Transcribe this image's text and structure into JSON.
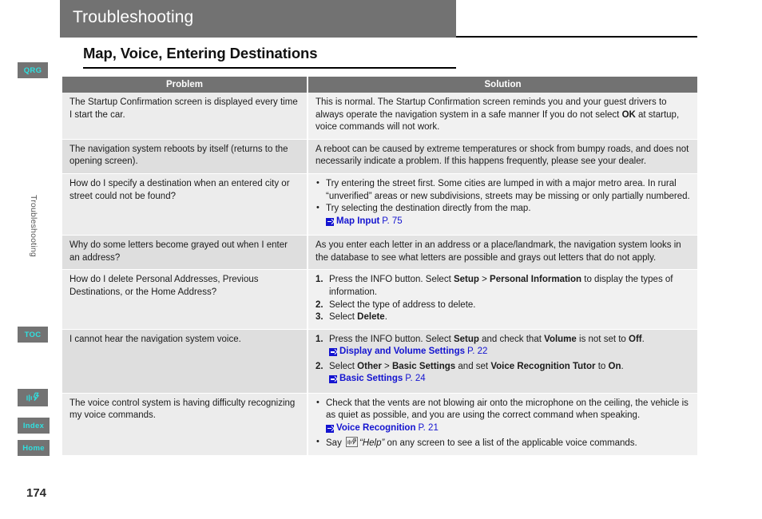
{
  "header": {
    "title": "Troubleshooting"
  },
  "section": {
    "title": "Map, Voice, Entering Destinations"
  },
  "sidebar": {
    "vertical_label": "Troubleshooting",
    "tabs": [
      {
        "id": "qrg",
        "label": "QRG"
      },
      {
        "id": "toc",
        "label": "TOC"
      },
      {
        "id": "voice",
        "label": "",
        "icon": "voice-icon"
      },
      {
        "id": "index",
        "label": "Index"
      },
      {
        "id": "home",
        "label": "Home"
      }
    ]
  },
  "table": {
    "headers": {
      "problem": "Problem",
      "solution": "Solution"
    },
    "rows": [
      {
        "problem": "The Startup Confirmation screen is displayed every time I start the car.",
        "solution_p1": "This is normal. The Startup Confirmation screen reminds you and your guest drivers to always operate the navigation system in a safe manner If you do not select ",
        "solution_b1": "OK",
        "solution_p2": " at startup, voice commands will not work."
      },
      {
        "problem": "The navigation system reboots by itself (returns to the opening screen).",
        "solution_p1": "A reboot can be caused by extreme temperatures or shock from bumpy roads, and does not necessarily indicate a problem. If this happens frequently, please see your dealer."
      },
      {
        "problem": "How do I specify a destination when an entered city or street could not be found?",
        "bullet1": "Try entering the street first. Some cities are lumped in with a major metro area. In rural “unverified” areas or new subdivisions, streets may be missing or only partially numbered.",
        "bullet2": "Try selecting the destination directly from the map.",
        "xref1_label": "Map Input",
        "xref1_page": "P. 75"
      },
      {
        "problem": "Why do some letters become grayed out when I enter an address?",
        "solution_p1": "As you enter each letter in an address or a place/landmark, the navigation system looks in the database to see what letters are possible and grays out letters that do not apply."
      },
      {
        "problem": "How do I delete Personal Addresses, Previous Destinations, or the Home Address?",
        "step1_a": "Press the INFO button. Select ",
        "step1_b1": "Setup",
        "step1_b": " > ",
        "step1_b2": "Personal Information",
        "step1_c": " to display the types of information.",
        "step2_a": "Select the type of address to delete.",
        "step3_a": "Select ",
        "step3_b1": "Delete",
        "step3_c": "."
      },
      {
        "problem": "I cannot hear the navigation system voice.",
        "step1_a": "Press the INFO button. Select ",
        "step1_b1": "Setup",
        "step1_b": " and check that ",
        "step1_b2": "Volume",
        "step1_c": " is not set to ",
        "step1_b3": "Off",
        "step1_d": ".",
        "xref1_label": "Display and Volume Settings",
        "xref1_page": "P. 22",
        "step2_a": "Select ",
        "step2_b1": "Other",
        "step2_b": " > ",
        "step2_b2": "Basic Settings",
        "step2_c": " and set ",
        "step2_b3": "Voice Recognition Tutor",
        "step2_d": " to ",
        "step2_b4": "On",
        "step2_e": ".",
        "xref2_label": "Basic Settings",
        "xref2_page": "P. 24"
      },
      {
        "problem": "The voice control system is having difficulty recognizing my voice commands.",
        "bullet1": "Check that the vents are not blowing air onto the microphone on the ceiling, the vehicle is as quiet as possible, and you are using the correct command when speaking.",
        "xref1_label": "Voice Recognition",
        "xref1_page": "P. 21",
        "bullet2_a": "Say ",
        "bullet2_quote": "“Help”",
        "bullet2_b": " on any screen to see a list of the applicable voice commands."
      }
    ]
  },
  "footer": {
    "page_number": "174"
  },
  "colors": {
    "header_gray": "#727272",
    "tab_gray": "#737373",
    "tab_text_cyan": "#2fe0e0",
    "xref_blue": "#1414d0",
    "row_light": "#ececec",
    "row_dark": "#dedede"
  }
}
